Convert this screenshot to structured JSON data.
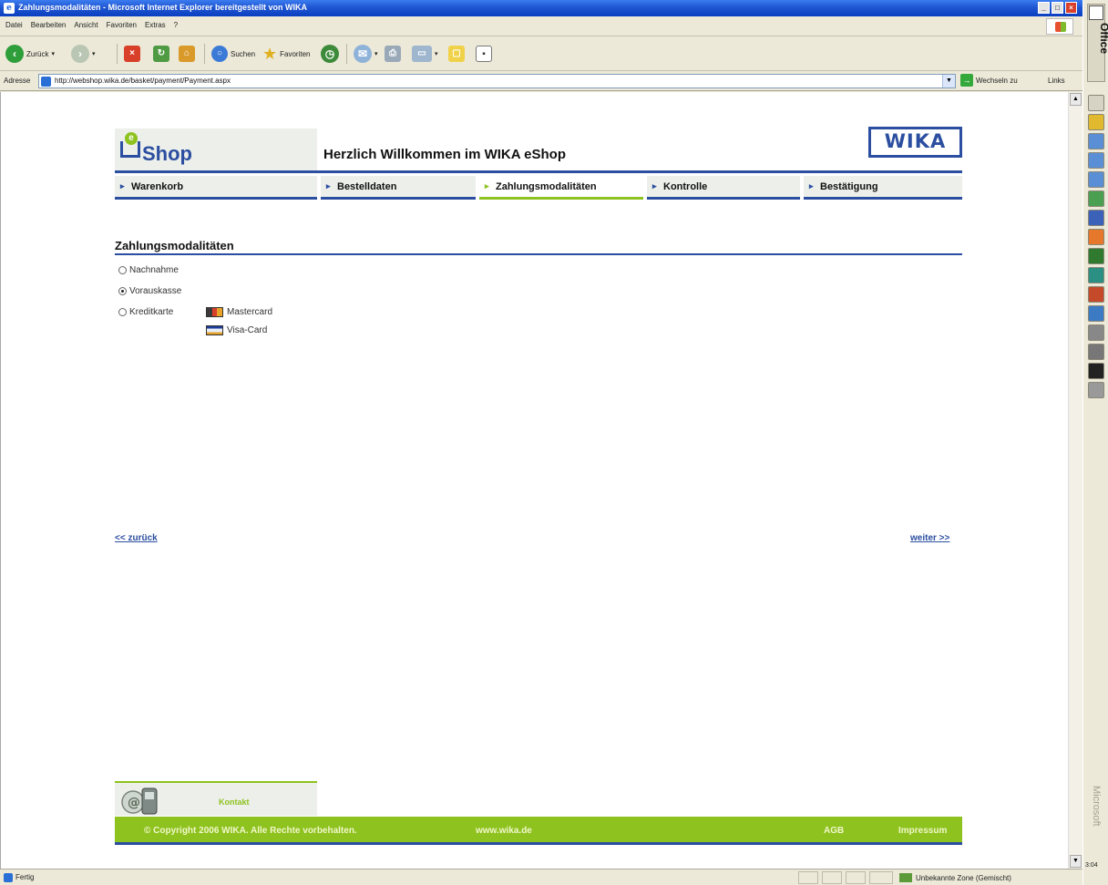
{
  "window": {
    "title": "Zahlungsmodalitäten - Microsoft Internet Explorer bereitgestellt von WIKA",
    "controls": [
      "_",
      "□",
      "×"
    ]
  },
  "menubar": {
    "items": [
      "Datei",
      "Bearbeiten",
      "Ansicht",
      "Favoriten",
      "Extras",
      "?"
    ]
  },
  "toolbar": {
    "back_label": "Zurück",
    "search_label": "Suchen",
    "favorites_label": "Favoriten"
  },
  "addressbar": {
    "label": "Adresse",
    "url": "http://webshop.wika.de/basket/payment/Payment.aspx",
    "go_label": "Wechseln zu",
    "links_label": "Links"
  },
  "officebar": {
    "title": "Office",
    "brand": "Microsoft",
    "clock": "3:04",
    "button_colors": [
      "#d6d3c4",
      "#e0b92e",
      "#5a8fd6",
      "#5a8fd6",
      "#5a8fd6",
      "#4aa050",
      "#3b62b8",
      "#e5782a",
      "#2f7a2f",
      "#2b8f84",
      "#c44a2a",
      "#3c7bc4",
      "#888888",
      "#777777",
      "#222222",
      "#999999"
    ]
  },
  "status": {
    "ready": "Fertig",
    "zone": "Unbekannte Zone (Gemischt)"
  },
  "page": {
    "logo_e": "e",
    "logo_text": "Shop",
    "welcome": "Herzlich Willkommen im WIKA eShop",
    "brand": "WIKA",
    "steps": [
      {
        "label": "Warenkorb"
      },
      {
        "label": "Bestelldaten"
      },
      {
        "label": "Zahlungsmodalitäten"
      },
      {
        "label": "Kontrolle"
      },
      {
        "label": "Bestätigung"
      }
    ],
    "active_step": "Zahlungsmodalitäten",
    "section_title": "Zahlungsmodalitäten",
    "payment_options": [
      {
        "label": "Nachnahme",
        "selected": false
      },
      {
        "label": "Vorauskasse",
        "selected": true
      },
      {
        "label": "Kreditkarte",
        "selected": false
      }
    ],
    "cards": [
      {
        "label": "Mastercard",
        "icon": "mastercard-icon"
      },
      {
        "label": "Visa-Card",
        "icon": "visa-icon"
      }
    ],
    "back_link": "<< zurück",
    "next_link": "weiter >>",
    "kontakt_label": "Kontakt",
    "footer": {
      "copyright": "© Copyright 2006 WIKA. Alle Rechte vorbehalten.",
      "website": "www.wika.de",
      "agb": "AGB",
      "impressum": "Impressum"
    },
    "colors": {
      "brand_blue": "#2b4ea0",
      "brand_green": "#8dc21f"
    }
  }
}
